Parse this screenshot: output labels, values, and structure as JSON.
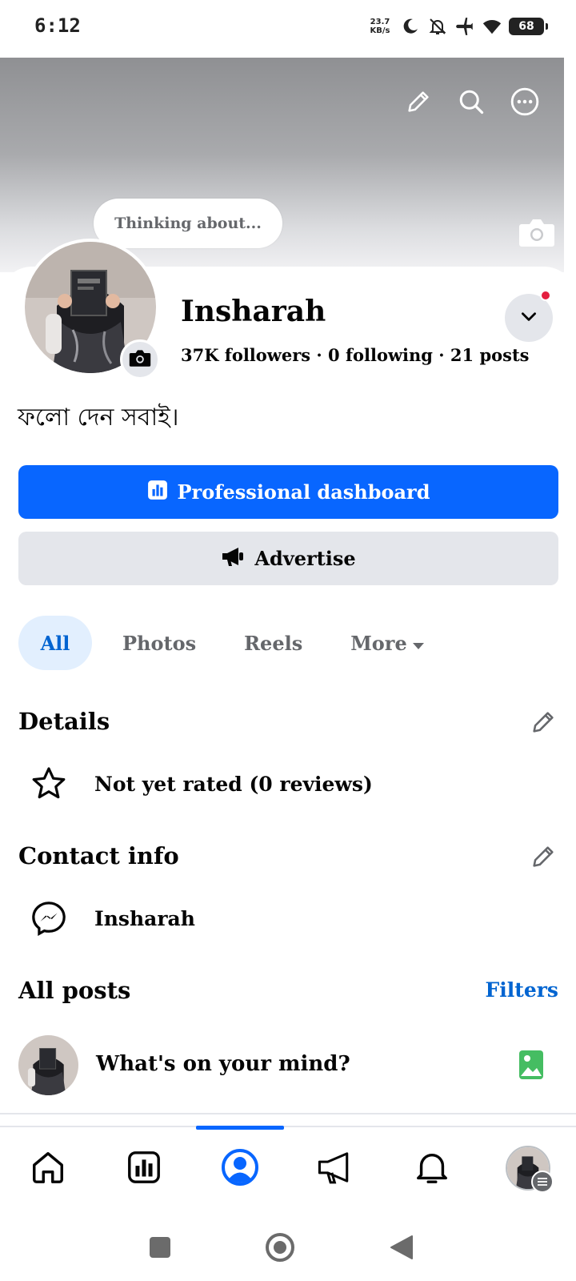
{
  "status_bar": {
    "time": "6:12",
    "net_speed_value": "23.7",
    "net_speed_unit": "KB/s",
    "battery": "68",
    "icons": [
      "moon-icon",
      "bell-off-icon",
      "airplane-icon",
      "wifi-icon"
    ]
  },
  "cover": {
    "actions": [
      "edit-icon",
      "search-icon",
      "more-icon"
    ],
    "camera_icon": "camera-icon"
  },
  "profile": {
    "thought_prompt": "Thinking about...",
    "name": "Insharah",
    "stats": "37K followers · 0 following · 21 posts",
    "bio": "ফলো দেন সবাই।"
  },
  "buttons": {
    "primary_label": "Professional dashboard",
    "secondary_label": "Advertise"
  },
  "tabs": [
    {
      "label": "All",
      "active": true
    },
    {
      "label": "Photos",
      "active": false
    },
    {
      "label": "Reels",
      "active": false
    },
    {
      "label": "More",
      "active": false
    }
  ],
  "details": {
    "title": "Details",
    "rating_text": "Not yet rated (0 reviews)"
  },
  "contact": {
    "title": "Contact info",
    "messenger_name": "Insharah"
  },
  "posts": {
    "title": "All posts",
    "filters_label": "Filters",
    "composer_placeholder": "What's on your mind?"
  },
  "bottom_nav": {
    "items": [
      "home-icon",
      "dashboard-icon",
      "profile-icon",
      "megaphone-icon",
      "bell-icon",
      "avatar-menu"
    ],
    "active": "profile-icon"
  },
  "colors": {
    "accent": "#0866ff",
    "link": "#0064d1",
    "secondary_button": "#e4e6eb",
    "notification_dot": "#e41e3f",
    "photo_icon": "#45bd62"
  }
}
